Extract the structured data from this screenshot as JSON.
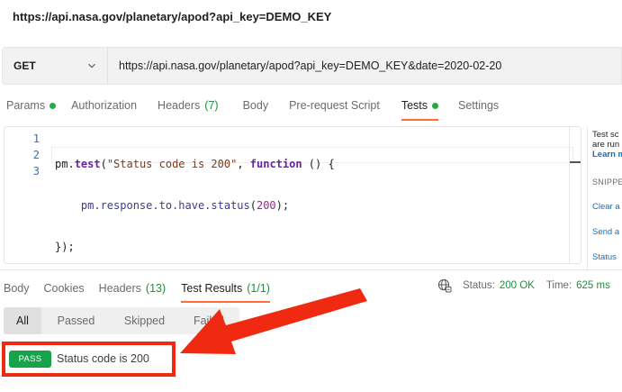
{
  "page_title": "https://api.nasa.gov/planetary/apod?api_key=DEMO_KEY",
  "request": {
    "method": "GET",
    "url": "https://api.nasa.gov/planetary/apod?api_key=DEMO_KEY&date=2020-02-20"
  },
  "request_tabs": [
    {
      "label": "Params"
    },
    {
      "label": "Authorization"
    },
    {
      "label": "Headers",
      "count": "(7)"
    },
    {
      "label": "Body"
    },
    {
      "label": "Pre-request Script"
    },
    {
      "label": "Tests"
    },
    {
      "label": "Settings"
    }
  ],
  "editor": {
    "line_numbers": [
      "1",
      "2",
      "3"
    ],
    "line1": {
      "obj": "pm",
      "dot": ".",
      "method": "test",
      "open": "(",
      "str": "\"Status code is 200\"",
      "sep": ", ",
      "kw": "function",
      "rest": " () {"
    },
    "line2": {
      "indent": "    ",
      "chain": "pm.response.to.have.status",
      "open": "(",
      "num": "200",
      "close": ");"
    },
    "line3": "});"
  },
  "side_panel": {
    "text1": "Test sc",
    "text2": "are run",
    "learn": "Learn m",
    "snippets_heading": "SNIPPE",
    "link1": "Clear a",
    "link2": "Send a",
    "link3": "Status"
  },
  "response_tabs": [
    {
      "label": "Body"
    },
    {
      "label": "Cookies"
    },
    {
      "label": "Headers",
      "count": "(13)"
    },
    {
      "label": "Test Results",
      "count": "(1/1)"
    }
  ],
  "status": {
    "status_label": "Status:",
    "status_value": "200 OK",
    "time_label": "Time:",
    "time_value": "625 ms"
  },
  "filters": [
    "All",
    "Passed",
    "Skipped",
    "Failed"
  ],
  "result": {
    "badge": "PASS",
    "name": "Status code is 200"
  },
  "colors": {
    "accent": "#ff6c37",
    "pass": "#16a34a",
    "highlight": "#f02a10"
  }
}
